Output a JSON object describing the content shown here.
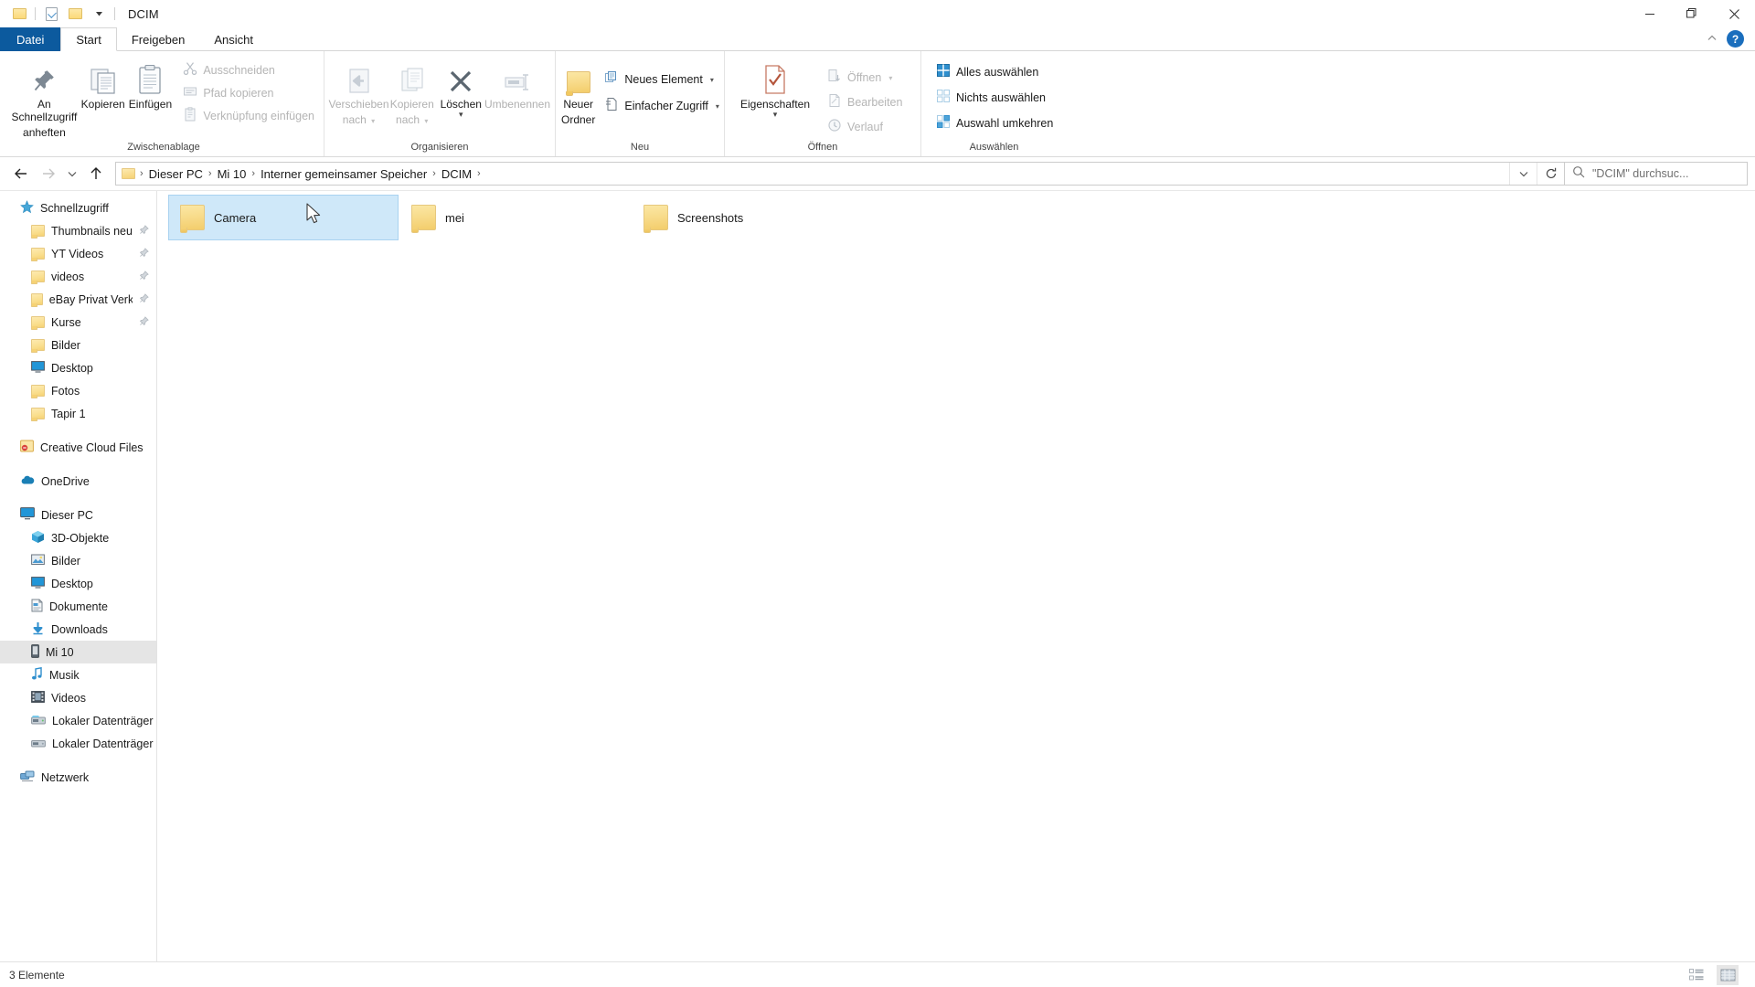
{
  "window": {
    "title": "DCIM",
    "quick_access": [
      "folder-icon",
      "properties-check-icon",
      "folder-icon",
      "customize-caret-icon"
    ],
    "controls": {
      "minimize": "minimize-icon",
      "maximize": "maximize-icon",
      "close": "close-icon"
    }
  },
  "tabs": [
    {
      "id": "datei",
      "label": "Datei"
    },
    {
      "id": "start",
      "label": "Start"
    },
    {
      "id": "freigeben",
      "label": "Freigeben"
    },
    {
      "id": "ansicht",
      "label": "Ansicht"
    }
  ],
  "ribbon": {
    "collapse_icon": "chevron-up-icon",
    "help_label": "?",
    "groups": [
      {
        "name": "Zwischenablage",
        "label": "Zwischenablage",
        "big_buttons": [
          {
            "id": "pin-quick-access",
            "label_line1": "An Schnellzugriff",
            "label_line2": "anheften",
            "icon": "pin-icon",
            "disabled": false
          },
          {
            "id": "copy",
            "label_line1": "Kopieren",
            "label_line2": "",
            "icon": "copy-icon",
            "disabled": false
          },
          {
            "id": "paste",
            "label_line1": "Einfügen",
            "label_line2": "",
            "icon": "paste-icon",
            "disabled": false
          }
        ],
        "small_buttons": [
          {
            "id": "cut",
            "label": "Ausschneiden",
            "icon": "scissors-icon",
            "disabled": true
          },
          {
            "id": "copy-path",
            "label": "Pfad kopieren",
            "icon": "copy-path-icon",
            "disabled": true
          },
          {
            "id": "paste-shortcut",
            "label": "Verknüpfung einfügen",
            "icon": "paste-shortcut-icon",
            "disabled": true
          }
        ]
      },
      {
        "name": "Organisieren",
        "label": "Organisieren",
        "big_buttons": [
          {
            "id": "move-to",
            "label_line1": "Verschieben",
            "label_line2": "nach",
            "icon": "move-to-icon",
            "disabled": true,
            "caret": true
          },
          {
            "id": "copy-to",
            "label_line1": "Kopieren",
            "label_line2": "nach",
            "icon": "copy-to-icon",
            "disabled": true,
            "caret": true
          },
          {
            "id": "delete",
            "label_line1": "Löschen",
            "label_line2": "",
            "icon": "delete-x-icon",
            "disabled": false,
            "caret": true
          },
          {
            "id": "rename",
            "label_line1": "Umbenennen",
            "label_line2": "",
            "icon": "rename-icon",
            "disabled": true
          }
        ],
        "small_buttons": []
      },
      {
        "name": "Neu",
        "label": "Neu",
        "big_buttons": [
          {
            "id": "new-folder",
            "label_line1": "Neuer",
            "label_line2": "Ordner",
            "icon": "new-folder-icon",
            "disabled": false
          }
        ],
        "small_buttons": [
          {
            "id": "new-item",
            "label": "Neues Element",
            "icon": "new-item-icon",
            "disabled": false,
            "caret": true
          },
          {
            "id": "easy-access",
            "label": "Einfacher Zugriff",
            "icon": "easy-access-icon",
            "disabled": false,
            "caret": true
          }
        ]
      },
      {
        "name": "Öffnen",
        "label": "Öffnen",
        "big_buttons": [
          {
            "id": "properties",
            "label_line1": "Eigenschaften",
            "label_line2": "",
            "icon": "properties-icon",
            "disabled": false,
            "caret": true
          }
        ],
        "small_buttons": [
          {
            "id": "open",
            "label": "Öffnen",
            "icon": "open-icon",
            "disabled": true,
            "caret": true
          },
          {
            "id": "edit",
            "label": "Bearbeiten",
            "icon": "edit-icon",
            "disabled": true
          },
          {
            "id": "history",
            "label": "Verlauf",
            "icon": "history-icon",
            "disabled": true
          }
        ]
      },
      {
        "name": "Auswählen",
        "label": "Auswählen",
        "big_buttons": [],
        "small_buttons": [
          {
            "id": "select-all",
            "label": "Alles auswählen",
            "icon": "select-all-icon",
            "disabled": false
          },
          {
            "id": "select-none",
            "label": "Nichts auswählen",
            "icon": "select-none-icon",
            "disabled": false
          },
          {
            "id": "invert-selection",
            "label": "Auswahl umkehren",
            "icon": "invert-selection-icon",
            "disabled": false
          }
        ]
      }
    ]
  },
  "navbar": {
    "back": "back-arrow-icon",
    "forward": "forward-arrow-icon",
    "recent": "chevron-down-icon",
    "up": "up-arrow-icon",
    "breadcrumbs": [
      "Dieser PC",
      "Mi 10",
      "Interner gemeinsamer Speicher",
      "DCIM"
    ],
    "dropdown_icon": "chevron-down-icon",
    "refresh_icon": "refresh-icon",
    "search": {
      "placeholder": "\"DCIM\" durchsuc...",
      "icon": "search-icon"
    }
  },
  "sidebar": {
    "sections": [
      {
        "id": "schnellzugriff",
        "root": {
          "label": "Schnellzugriff",
          "icon": "star-icon"
        },
        "items": [
          {
            "label": "Thumbnails neu",
            "icon": "folder-icon",
            "pinned": true
          },
          {
            "label": "YT Videos",
            "icon": "folder-icon",
            "pinned": true
          },
          {
            "label": "videos",
            "icon": "folder-icon",
            "pinned": true
          },
          {
            "label": "eBay Privat Verkauf",
            "icon": "folder-icon",
            "pinned": true
          },
          {
            "label": "Kurse",
            "icon": "folder-icon",
            "pinned": true
          },
          {
            "label": "Bilder",
            "icon": "folder-icon",
            "pinned": false
          },
          {
            "label": "Desktop",
            "icon": "desktop-icon",
            "pinned": false
          },
          {
            "label": "Fotos",
            "icon": "folder-icon",
            "pinned": false
          },
          {
            "label": "Tapir 1",
            "icon": "folder-icon",
            "pinned": false
          }
        ]
      },
      {
        "id": "creative-cloud",
        "root": {
          "label": "Creative Cloud Files",
          "icon": "creative-cloud-icon"
        },
        "items": []
      },
      {
        "id": "onedrive",
        "root": {
          "label": "OneDrive",
          "icon": "onedrive-cloud-icon"
        },
        "items": []
      },
      {
        "id": "dieser-pc",
        "root": {
          "label": "Dieser PC",
          "icon": "computer-icon"
        },
        "items": [
          {
            "label": "3D-Objekte",
            "icon": "3d-objects-icon",
            "pinned": false
          },
          {
            "label": "Bilder",
            "icon": "pictures-icon",
            "pinned": false
          },
          {
            "label": "Desktop",
            "icon": "desktop-icon",
            "pinned": false
          },
          {
            "label": "Dokumente",
            "icon": "documents-icon",
            "pinned": false
          },
          {
            "label": "Downloads",
            "icon": "downloads-arrow-icon",
            "pinned": false
          },
          {
            "label": "Mi 10",
            "icon": "phone-icon",
            "pinned": false,
            "selected": true
          },
          {
            "label": "Musik",
            "icon": "music-note-icon",
            "pinned": false
          },
          {
            "label": "Videos",
            "icon": "videos-icon",
            "pinned": false
          },
          {
            "label": "Lokaler Datenträger (C",
            "icon": "system-drive-icon",
            "pinned": false
          },
          {
            "label": "Lokaler Datenträger (D",
            "icon": "drive-icon",
            "pinned": false
          }
        ]
      },
      {
        "id": "netzwerk",
        "root": {
          "label": "Netzwerk",
          "icon": "network-icon"
        },
        "items": []
      }
    ]
  },
  "content": {
    "items": [
      {
        "name": "Camera",
        "icon": "folder-icon",
        "selected": true
      },
      {
        "name": "mei",
        "icon": "folder-icon",
        "selected": false
      },
      {
        "name": "Screenshots",
        "icon": "folder-icon",
        "selected": false
      }
    ],
    "cursor": "arrow-cursor"
  },
  "statusbar": {
    "item_count": "3 Elemente",
    "views": [
      {
        "id": "details-view",
        "icon": "details-view-icon",
        "active": false
      },
      {
        "id": "large-icons-view",
        "icon": "large-icons-view-icon",
        "active": true
      }
    ]
  },
  "colors": {
    "accent": "#0c5a9e",
    "selection": "#cfe8f9",
    "selection_border": "#a9d2f0",
    "sidebar_selected": "#e5e5e5",
    "folder_yellow": "#f8dc8c",
    "disabled_text": "#b5b5b5"
  }
}
